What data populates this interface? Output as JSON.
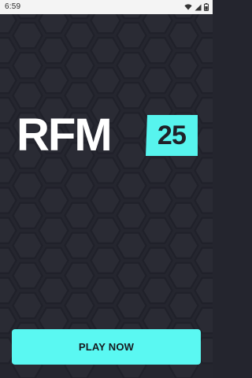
{
  "statusbar": {
    "time": "6:59",
    "icons": [
      "wifi-icon",
      "cellular-signal-icon",
      "battery-icon"
    ]
  },
  "logo": {
    "letters": "RFM",
    "badge": "25"
  },
  "actions": {
    "play_label": "PLAY NOW"
  },
  "colors": {
    "background": "#25262f",
    "accent": "#5af8f2",
    "logo_text": "#ffffff"
  }
}
